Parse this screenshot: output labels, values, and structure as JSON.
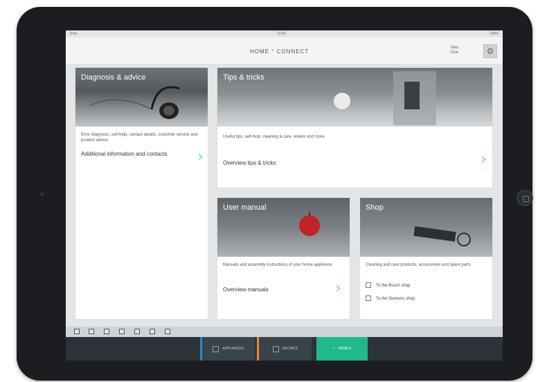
{
  "app": {
    "logo_text_left": "HOME",
    "logo_text_right": "CONNECT",
    "user_menu": [
      "Max",
      "Doe"
    ],
    "status_time": "12:00",
    "status_left": "iPad",
    "status_right": "100%"
  },
  "tiles": {
    "diagnosis": {
      "title": "Diagnosis & advice",
      "description": "Error diagnosis, self-help, contact details, customer service and product advice",
      "link": "Additional information and contacts"
    },
    "tips": {
      "title": "Tips & tricks",
      "description": "Useful tips, self-help, cleaning & care, videos and more",
      "link": "Overview tips & tricks"
    },
    "manual": {
      "title": "User manual",
      "description": "Manuals and assembly instructions of your home appliance",
      "link": "Overview manuals"
    },
    "shop": {
      "title": "Shop",
      "description": "Cleaning and care products, accessories and spare parts",
      "options": [
        "To the Bosch shop",
        "To the Siemens shop"
      ]
    }
  },
  "bottom_nav": {
    "appliances": "APPLIANCES",
    "recipes": "RECIPES",
    "world": "WORLD"
  },
  "colors": {
    "accent_teal": "#2ec5a4",
    "nav_blue": "#2f86c9",
    "nav_orange": "#f08a2a",
    "nav_green": "#1fba8c"
  }
}
